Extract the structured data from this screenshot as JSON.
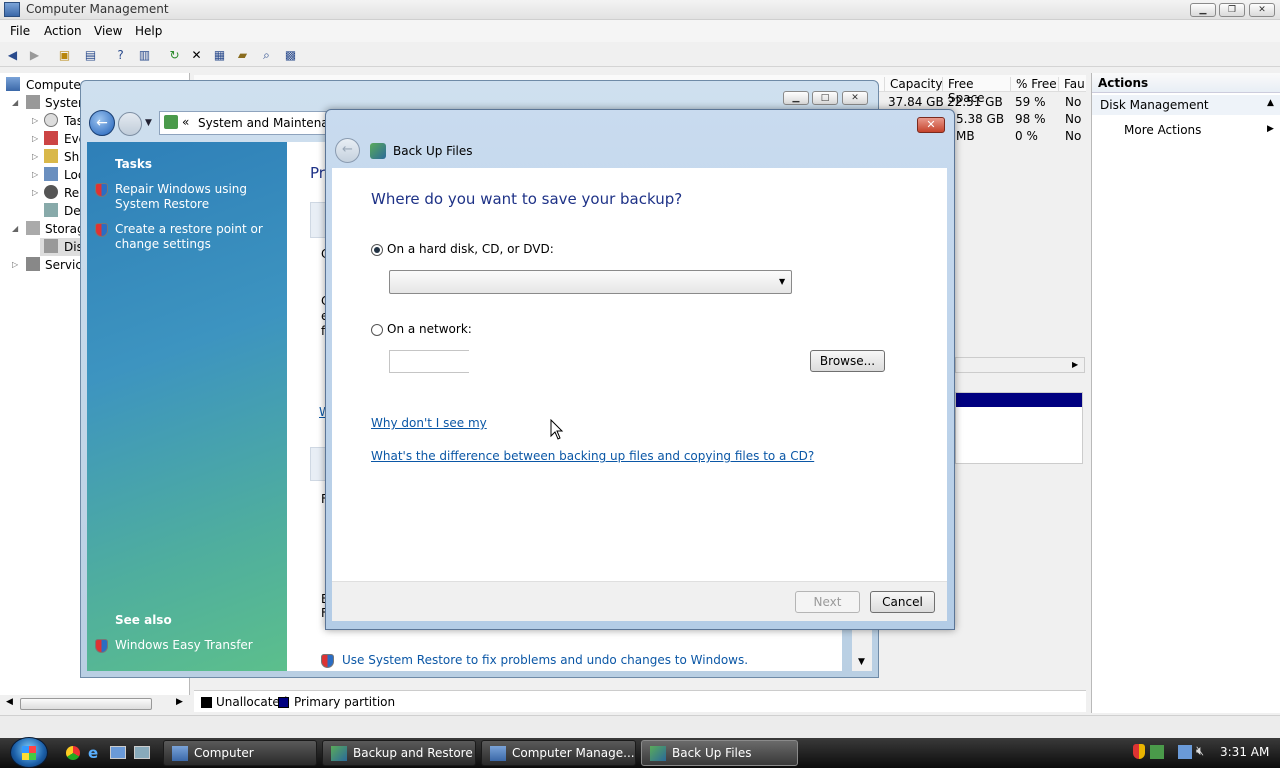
{
  "cm": {
    "title": "Computer Management",
    "menu": [
      "File",
      "Action",
      "View",
      "Help"
    ],
    "tree": {
      "root": "Computer M",
      "items": [
        "System",
        "Tas",
        "Eve",
        "Sha",
        "Loc",
        "Rel",
        "Dev",
        "Storag",
        "Dis",
        "Service"
      ]
    },
    "list": {
      "headers": [
        "Capacity",
        "Free Space",
        "% Free",
        "Fau"
      ],
      "rows": [
        [
          "37.84 GB",
          "22.51 GB",
          "59 %",
          "No"
        ],
        [
          "",
          "5.38 GB",
          "98 %",
          "No"
        ],
        [
          "",
          "MB",
          "0 %",
          "No"
        ]
      ]
    },
    "actions": {
      "header": "Actions",
      "section": "Disk Management",
      "more": "More Actions"
    },
    "legend": [
      "Unallocated",
      "Primary partition"
    ],
    "colors": {
      "unallocated": "#000000",
      "primary": "#000080"
    }
  },
  "cp": {
    "address": "System and Maintenanc",
    "breadcrumb_sep": "«",
    "tasks_header": "Tasks",
    "tasks": [
      "Repair Windows using System Restore",
      "Create a restore point or change settings"
    ],
    "see_also_header": "See also",
    "see_also": [
      "Windows Easy Transfer"
    ],
    "content_frag": [
      "Pr",
      "C",
      "C",
      "e",
      "f",
      "W",
      "F",
      "R",
      "E",
      "F"
    ],
    "system_restore_link": "Use System Restore to fix problems and undo changes to Windows."
  },
  "dlg": {
    "title": "Back Up Files",
    "heading": "Where do you want to save your backup?",
    "opt_disk": "On a hard disk, CD, or DVD:",
    "opt_network": "On a network:",
    "browse": "Browse...",
    "link1": "Why don't I see my",
    "link2": "What's the difference between backing up files and copying files to a CD?",
    "next": "Next",
    "cancel": "Cancel",
    "selected_option": "disk"
  },
  "taskbar": {
    "buttons": [
      "Computer",
      "Backup and Restore ...",
      "Computer Manage...",
      "Back Up Files"
    ],
    "active": "Back Up Files",
    "clock": "3:31 AM"
  }
}
